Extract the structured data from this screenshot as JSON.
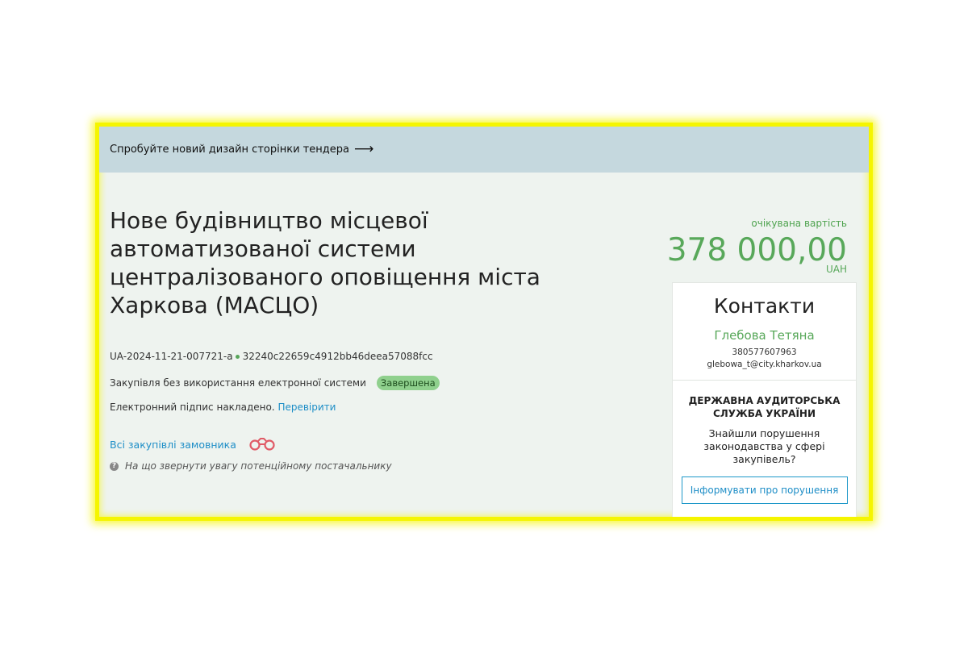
{
  "banner": {
    "text": "Спробуйте новий дизайн сторінки тендера",
    "arrow": "⟶"
  },
  "tender": {
    "title": "Нове будівництво місцевої автоматизованої системи централізованого оповіщення міста Харкова (МАСЦО)",
    "id": "UA-2024-11-21-007721-a",
    "hash": "32240c22659c4912bb46deea57088fcc",
    "method": "Закупівля без використання електронної системи",
    "status": "Завершена",
    "signature_text": "Електронний підпис накладено.",
    "signature_link": "Перевірити",
    "all_purchases_link": "Всі закупівлі замовника",
    "help_text": "На що звернути увагу потенційному постачальнику",
    "help_icon": "question-circle-icon",
    "binoculars_icon": "binoculars-icon"
  },
  "price": {
    "label": "очікувана вартість",
    "value": "378 000,00",
    "currency": "UAH"
  },
  "contacts": {
    "title": "Контакти",
    "name": "Глебова Тетяна",
    "phone": "380577607963",
    "email": "glebowa_t@city.kharkov.ua"
  },
  "audit": {
    "title": "ДЕРЖАВНА АУДИТОРСЬКА СЛУЖБА УКРАЇНИ",
    "text": "Знайшли порушення законодавства у сфері закупівель?",
    "button": "Інформувати про порушення"
  },
  "colors": {
    "highlight_border": "#f5f500",
    "banner_bg": "#c5d8de",
    "page_bg": "#eef3ef",
    "accent_green": "#58a85a",
    "link_blue": "#1e8ec7",
    "badge_bg": "#8fd08d"
  }
}
